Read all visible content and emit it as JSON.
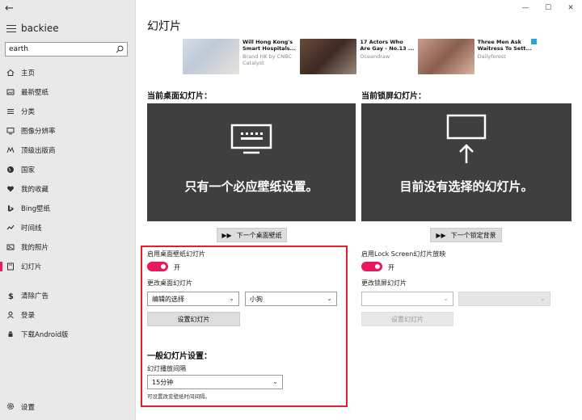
{
  "window": {
    "back_glyph": "←",
    "minimize_glyph": "—",
    "maximize_glyph": "☐",
    "close_glyph": "✕"
  },
  "sidebar": {
    "app_name": "backiee",
    "search": {
      "value": "earth",
      "placeholder": ""
    },
    "items": [
      {
        "icon": "home-icon",
        "label": "主页"
      },
      {
        "icon": "image-icon",
        "label": "最新壁纸"
      },
      {
        "icon": "list-icon",
        "label": "分类"
      },
      {
        "icon": "monitor-icon",
        "label": "图像分辨率"
      },
      {
        "icon": "vendor-icon",
        "label": "顶级出版商"
      },
      {
        "icon": "globe-icon",
        "label": "国家"
      },
      {
        "icon": "heart-icon",
        "label": "我的收藏"
      },
      {
        "icon": "bing-icon",
        "label": "Bing壁纸"
      },
      {
        "icon": "timeline-icon",
        "label": "时间线"
      },
      {
        "icon": "photo-icon",
        "label": "我的照片"
      },
      {
        "icon": "slideshow-icon",
        "label": "幻灯片"
      }
    ],
    "bottom_items": [
      {
        "icon": "dollar-icon",
        "label": "清除广告"
      },
      {
        "icon": "user-icon",
        "label": "登录"
      },
      {
        "icon": "android-icon",
        "label": "下载Android版"
      }
    ],
    "settings_label": "设置"
  },
  "main": {
    "title": "幻灯片",
    "ads": [
      {
        "headline1": "Will Hong Kong's",
        "headline2": "Smart Hospitals...",
        "source1": "Brand HK by CNBC",
        "source2": "Catalyst"
      },
      {
        "headline1": "17 Actors Who",
        "headline2": "Are Gay - No.13 ...",
        "source1": "Oceandraw",
        "source2": ""
      },
      {
        "headline1": "Three Men Ask",
        "headline2": "Waitress To Sett...",
        "source1": "Dailyforest",
        "source2": ""
      }
    ],
    "desktop": {
      "section_title": "当前桌面幻灯片：",
      "panel_text": "只有一个必应壁纸设置。",
      "next_button": "下一个桌面壁纸",
      "enable_label": "启用桌面壁纸幻灯片",
      "toggle_state": "开",
      "change_label": "更改桌面幻灯片",
      "select1": "编辑的选择",
      "select2": "小狗",
      "set_button": "设置幻灯片"
    },
    "lockscreen": {
      "section_title": "当前锁屏幻灯片：",
      "panel_text": "目前没有选择的幻灯片。",
      "next_button": "下一个锁定背景",
      "enable_label": "启用Lock Screen幻灯片放映",
      "toggle_state": "开",
      "change_label": "更改锁屏幻灯片",
      "select1": "",
      "select2": "",
      "set_button": "设置幻灯片"
    },
    "general": {
      "title": "一般幻灯片设置：",
      "interval_label": "幻灯播放间隔",
      "interval_value": "15分钟",
      "hint": "可设置改变壁纸时间间隔。"
    }
  }
}
